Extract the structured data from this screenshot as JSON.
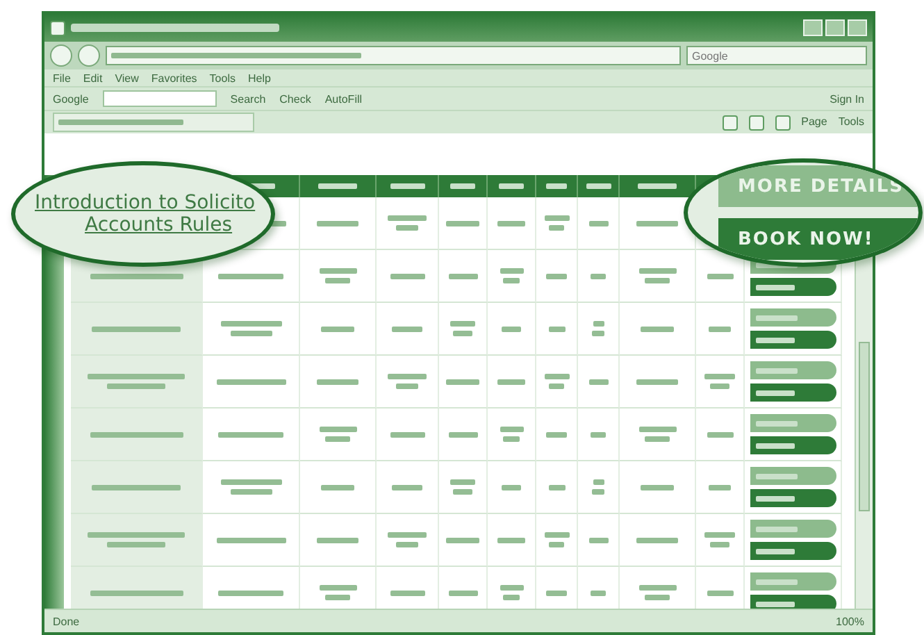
{
  "menu": [
    "File",
    "Edit",
    "View",
    "Favorites",
    "Tools",
    "Help"
  ],
  "toolbar": {
    "brand": "Google",
    "search_button": "Search",
    "check": "Check",
    "autofill": "AutoFill",
    "sign_in": "Sign In",
    "page": "Page",
    "tools": "Tools"
  },
  "search_box": {
    "placeholder": "Google"
  },
  "callout_course": {
    "title": "Introduction to Solicito",
    "subtitle": "Accounts Rules"
  },
  "callout_buttons": [
    {
      "kind": "details",
      "label": "MORE DETAILS"
    },
    {
      "kind": "book",
      "label": "BOOK NOW!"
    }
  ],
  "status_bar": {
    "text": "Done",
    "zoom": "100%"
  }
}
